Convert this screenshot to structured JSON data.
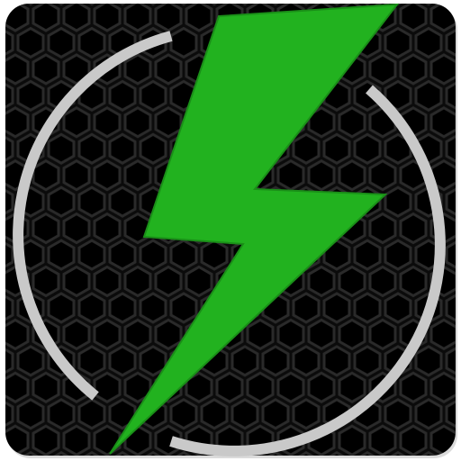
{
  "icon": {
    "semantic": "lightning-bolt-power-icon",
    "colors": {
      "background": "#0b0b0b",
      "hex_mesh": "#2a2a2a",
      "hex_highlight": "#3a3a3a",
      "ring": "#c9c9c9",
      "bolt": "#22b21f",
      "bolt_edge": "#1a8f18",
      "shadow": "#bdbdbd"
    }
  }
}
